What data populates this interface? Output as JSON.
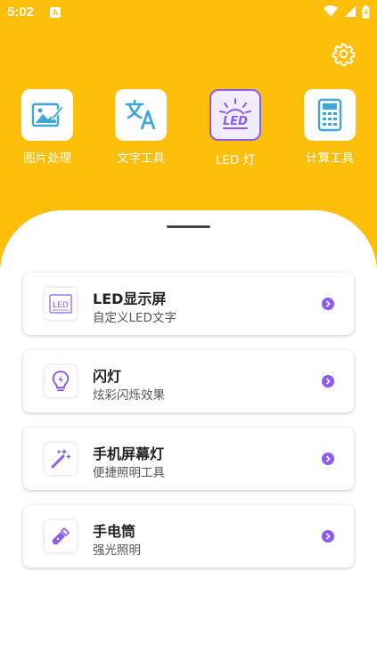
{
  "status_bar": {
    "time": "5:02",
    "notification_glyph": "A"
  },
  "header": {
    "settings_icon": "gear-icon"
  },
  "tools": [
    {
      "label": "图片处理",
      "icon": "image-edit-icon"
    },
    {
      "label": "文字工具",
      "icon": "translate-icon"
    },
    {
      "label": "LED 灯",
      "icon": "led-icon",
      "selected": true
    },
    {
      "label": "计算工具",
      "icon": "calculator-icon"
    }
  ],
  "menu": [
    {
      "title": "LED显示屏",
      "subtitle": "自定义LED文字",
      "icon": "led-screen-icon"
    },
    {
      "title": "闪灯",
      "subtitle": "炫彩闪烁效果",
      "icon": "bulb-icon"
    },
    {
      "title": "手机屏幕灯",
      "subtitle": "便捷照明工具",
      "icon": "magic-wand-icon"
    },
    {
      "title": "手电筒",
      "subtitle": "强光照明",
      "icon": "flashlight-icon"
    }
  ],
  "colors": {
    "header_bg": "#FDBF0A",
    "accent": "#8A5CF0",
    "icon_blue": "#3FA6D6"
  }
}
